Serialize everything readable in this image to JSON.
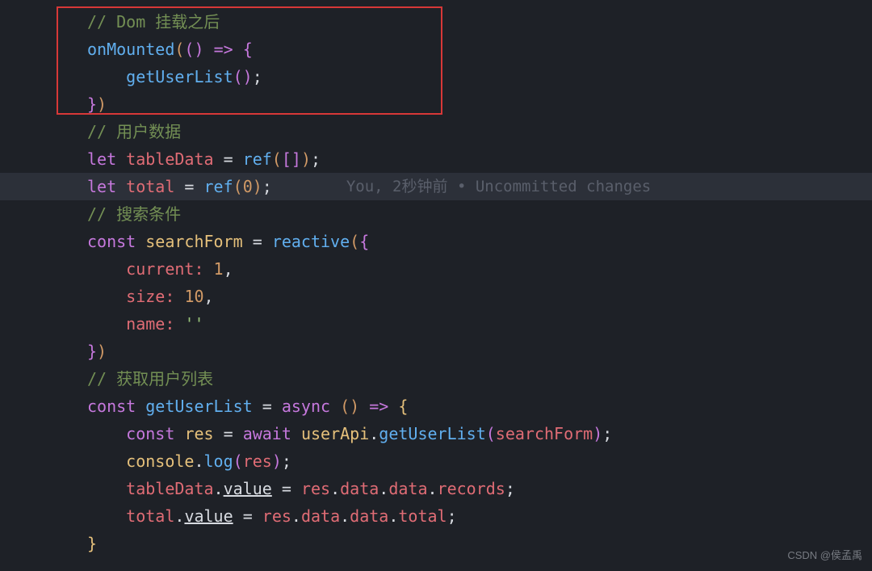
{
  "code": {
    "l1_comment": "// Dom 挂载之后",
    "l2_onmounted": "onMounted",
    "l2_arrow": "=>",
    "l3_getuserlist": "getUserList",
    "l5_comment": "// 用户数据",
    "l6_let": "let",
    "l6_tabledata": "tableData",
    "l6_ref": "ref",
    "l7_let": "let",
    "l7_total": "total",
    "l7_ref": "ref",
    "l7_zero": "0",
    "l8_comment": "// 搜索条件",
    "l9_const": "const",
    "l9_searchform": "searchForm",
    "l9_reactive": "reactive",
    "l10_current": "current:",
    "l10_val": "1",
    "l11_size": "size:",
    "l11_val": "10",
    "l12_name": "name:",
    "l12_val": "''",
    "l14_comment": "// 获取用户列表",
    "l15_const": "const",
    "l15_getuserlist": "getUserList",
    "l15_async": "async",
    "l15_arrow": "=>",
    "l16_const": "const",
    "l16_res": "res",
    "l16_await": "await",
    "l16_userapi": "userApi",
    "l16_getuserlist": "getUserList",
    "l16_searchform": "searchForm",
    "l17_console": "console",
    "l17_log": "log",
    "l17_res": "res",
    "l18_tabledata": "tableData",
    "l18_value": "value",
    "l18_res": "res",
    "l18_data1": "data",
    "l18_data2": "data",
    "l18_records": "records",
    "l19_total": "total",
    "l19_value": "value",
    "l19_res": "res",
    "l19_data1": "data",
    "l19_data2": "data",
    "l19_totalp": "total"
  },
  "gitlens": {
    "author": "You",
    "time": "2秒钟前",
    "separator": "•",
    "message": "Uncommitted changes"
  },
  "watermark": "CSDN @侯孟禹"
}
